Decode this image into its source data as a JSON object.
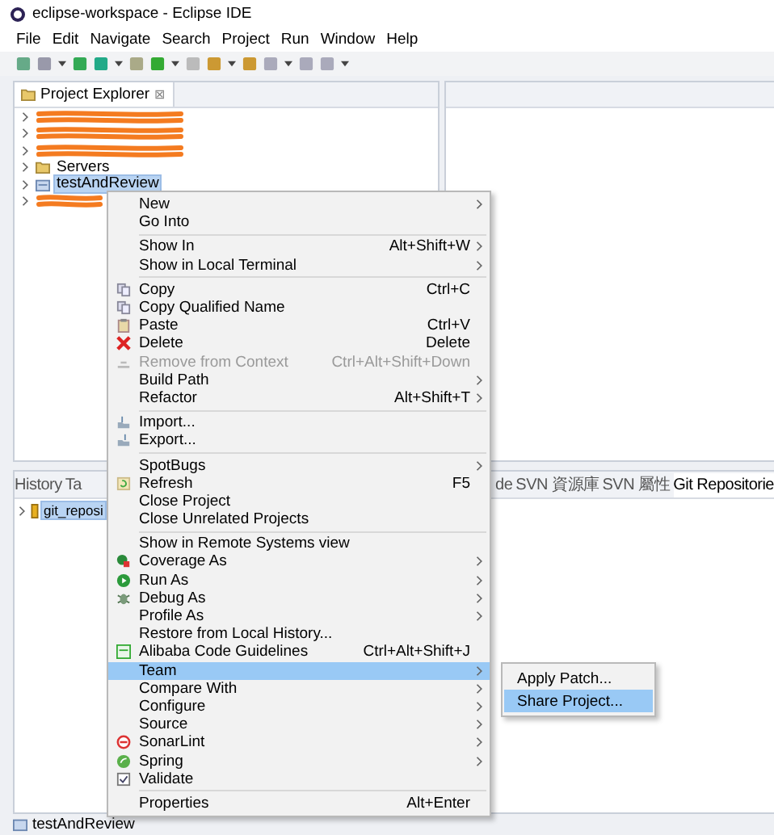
{
  "window": {
    "title": "eclipse-workspace - Eclipse IDE"
  },
  "menubar": [
    "File",
    "Edit",
    "Navigate",
    "Search",
    "Project",
    "Run",
    "Window",
    "Help"
  ],
  "explorer": {
    "title": "Project Explorer",
    "close": "⊠",
    "items": [
      {
        "kind": "redacted",
        "selected": false
      },
      {
        "kind": "redacted",
        "selected": false
      },
      {
        "kind": "redacted",
        "selected": false
      },
      {
        "kind": "folder",
        "label": "Servers",
        "selected": false
      },
      {
        "kind": "project",
        "label": "testAndReview",
        "selected": true
      },
      {
        "kind": "redacted",
        "selected": false
      }
    ]
  },
  "context_menu": [
    {
      "kind": "item",
      "label": "New",
      "submenu": true,
      "disabled": false,
      "selected": false
    },
    {
      "kind": "item",
      "label": "Go Into",
      "submenu": false,
      "disabled": false,
      "selected": false
    },
    {
      "kind": "separator"
    },
    {
      "kind": "item",
      "label": "Show In",
      "shortcut": "Alt+Shift+W",
      "submenu": true,
      "disabled": false,
      "selected": false
    },
    {
      "kind": "item",
      "label": "Show in Local Terminal",
      "submenu": true,
      "disabled": false,
      "selected": false
    },
    {
      "kind": "separator"
    },
    {
      "kind": "item",
      "label": "Copy",
      "shortcut": "Ctrl+C",
      "submenu": false,
      "disabled": false,
      "selected": false
    },
    {
      "kind": "item",
      "label": "Copy Qualified Name",
      "submenu": false,
      "disabled": false,
      "selected": false
    },
    {
      "kind": "item",
      "label": "Paste",
      "shortcut": "Ctrl+V",
      "submenu": false,
      "disabled": false,
      "selected": false
    },
    {
      "kind": "item",
      "label": "Delete",
      "shortcut": "Delete",
      "submenu": false,
      "disabled": false,
      "selected": false
    },
    {
      "kind": "item",
      "label": "Remove from Context",
      "shortcut": "Ctrl+Alt+Shift+Down",
      "submenu": false,
      "disabled": true,
      "selected": false
    },
    {
      "kind": "item",
      "label": "Build Path",
      "submenu": true,
      "disabled": false,
      "selected": false
    },
    {
      "kind": "item",
      "label": "Refactor",
      "shortcut": "Alt+Shift+T",
      "submenu": true,
      "disabled": false,
      "selected": false
    },
    {
      "kind": "separator"
    },
    {
      "kind": "item",
      "label": "Import...",
      "submenu": false,
      "disabled": false,
      "selected": false
    },
    {
      "kind": "item",
      "label": "Export...",
      "submenu": false,
      "disabled": false,
      "selected": false
    },
    {
      "kind": "separator"
    },
    {
      "kind": "item",
      "label": "SpotBugs",
      "submenu": true,
      "disabled": false,
      "selected": false
    },
    {
      "kind": "item",
      "label": "Refresh",
      "shortcut": "F5",
      "submenu": false,
      "disabled": false,
      "selected": false
    },
    {
      "kind": "item",
      "label": "Close Project",
      "submenu": false,
      "disabled": false,
      "selected": false
    },
    {
      "kind": "item",
      "label": "Close Unrelated Projects",
      "submenu": false,
      "disabled": false,
      "selected": false
    },
    {
      "kind": "separator"
    },
    {
      "kind": "item",
      "label": "Show in Remote Systems view",
      "submenu": false,
      "disabled": false,
      "selected": false
    },
    {
      "kind": "item",
      "label": "Coverage As",
      "submenu": true,
      "disabled": false,
      "selected": false
    },
    {
      "kind": "item",
      "label": "Run As",
      "submenu": true,
      "disabled": false,
      "selected": false
    },
    {
      "kind": "item",
      "label": "Debug As",
      "submenu": true,
      "disabled": false,
      "selected": false
    },
    {
      "kind": "item",
      "label": "Profile As",
      "submenu": true,
      "disabled": false,
      "selected": false
    },
    {
      "kind": "item",
      "label": "Restore from Local History...",
      "submenu": false,
      "disabled": false,
      "selected": false
    },
    {
      "kind": "item",
      "label": "Alibaba Code Guidelines",
      "shortcut": "Ctrl+Alt+Shift+J",
      "submenu": false,
      "disabled": false,
      "selected": false
    },
    {
      "kind": "item",
      "label": "Team",
      "submenu": true,
      "disabled": false,
      "selected": true
    },
    {
      "kind": "item",
      "label": "Compare With",
      "submenu": true,
      "disabled": false,
      "selected": false
    },
    {
      "kind": "item",
      "label": "Configure",
      "submenu": true,
      "disabled": false,
      "selected": false
    },
    {
      "kind": "item",
      "label": "Source",
      "submenu": true,
      "disabled": false,
      "selected": false
    },
    {
      "kind": "item",
      "label": "SonarLint",
      "submenu": true,
      "disabled": false,
      "selected": false
    },
    {
      "kind": "item",
      "label": "Spring",
      "submenu": true,
      "disabled": false,
      "selected": false
    },
    {
      "kind": "item",
      "label": "Validate",
      "submenu": false,
      "disabled": false,
      "selected": false
    },
    {
      "kind": "separator"
    },
    {
      "kind": "item",
      "label": "Properties",
      "shortcut": "Alt+Enter",
      "submenu": false,
      "disabled": false,
      "selected": false
    }
  ],
  "team_submenu": [
    {
      "label": "Apply Patch...",
      "selected": false
    },
    {
      "label": "Share Project...",
      "selected": true
    }
  ],
  "bottom_panel": {
    "tabs_left": [
      {
        "label": "History",
        "selected": false
      },
      {
        "label": "Ta",
        "selected": false
      }
    ],
    "tabs_right": [
      {
        "label": "de",
        "selected": false
      },
      {
        "label": "SVN 資源庫",
        "selected": false
      },
      {
        "label": "SVN 屬性",
        "selected": false
      },
      {
        "label": "Git Repositorie",
        "selected": true
      }
    ],
    "items": [
      {
        "label": "git_reposi",
        "selected": true
      }
    ]
  },
  "status_bar": {
    "text": "testAndReview"
  }
}
